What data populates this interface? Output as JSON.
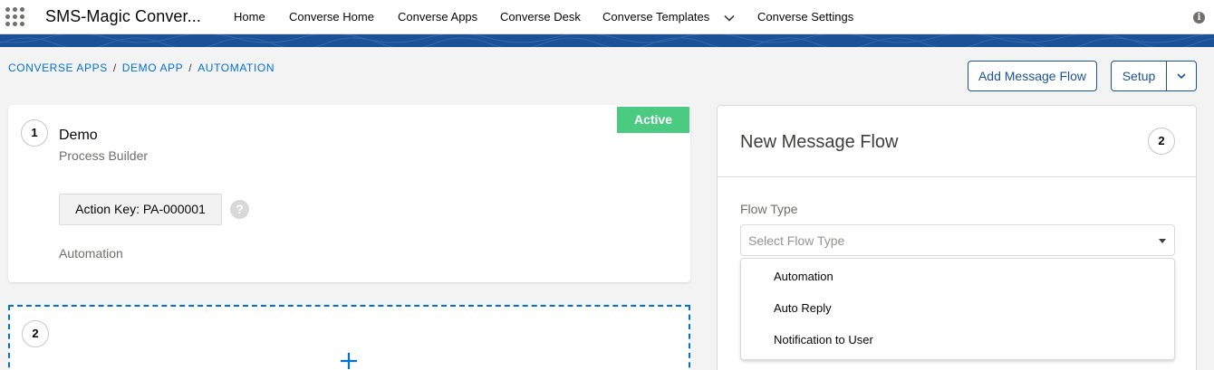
{
  "nav": {
    "app_name": "SMS-Magic Conver...",
    "items": [
      "Home",
      "Converse Home",
      "Converse Apps",
      "Converse Desk",
      "Converse Templates",
      "Converse Settings"
    ],
    "info_glyph": "i"
  },
  "breadcrumb": {
    "items": [
      "CONVERSE APPS",
      "DEMO APP",
      "AUTOMATION"
    ],
    "separator": "/"
  },
  "toolbar": {
    "add_label": "Add Message Flow",
    "setup_label": "Setup"
  },
  "flow_card": {
    "step": "1",
    "status": "Active",
    "title": "Demo",
    "subtitle": "Process Builder",
    "action_key": "Action Key: PA-000001",
    "help_glyph": "?",
    "footer": "Automation"
  },
  "new_slot": {
    "step": "2"
  },
  "panel": {
    "title": "New Message Flow",
    "step": "2",
    "flow_type_label": "Flow Type",
    "select_placeholder": "Select Flow Type",
    "options": [
      "Automation",
      "Auto Reply",
      "Notification to User"
    ]
  },
  "colors": {
    "brand": "#1b5297",
    "link": "#0070d2",
    "active": "#4bca81"
  },
  "icons": {
    "app_launcher": "waffle-icon",
    "nav_chevron": "chevron-down-icon",
    "info": "info-icon",
    "setup_dropdown": "chevron-down-icon",
    "help": "question-icon",
    "add": "plus-icon",
    "select_caret": "caret-down-icon"
  }
}
